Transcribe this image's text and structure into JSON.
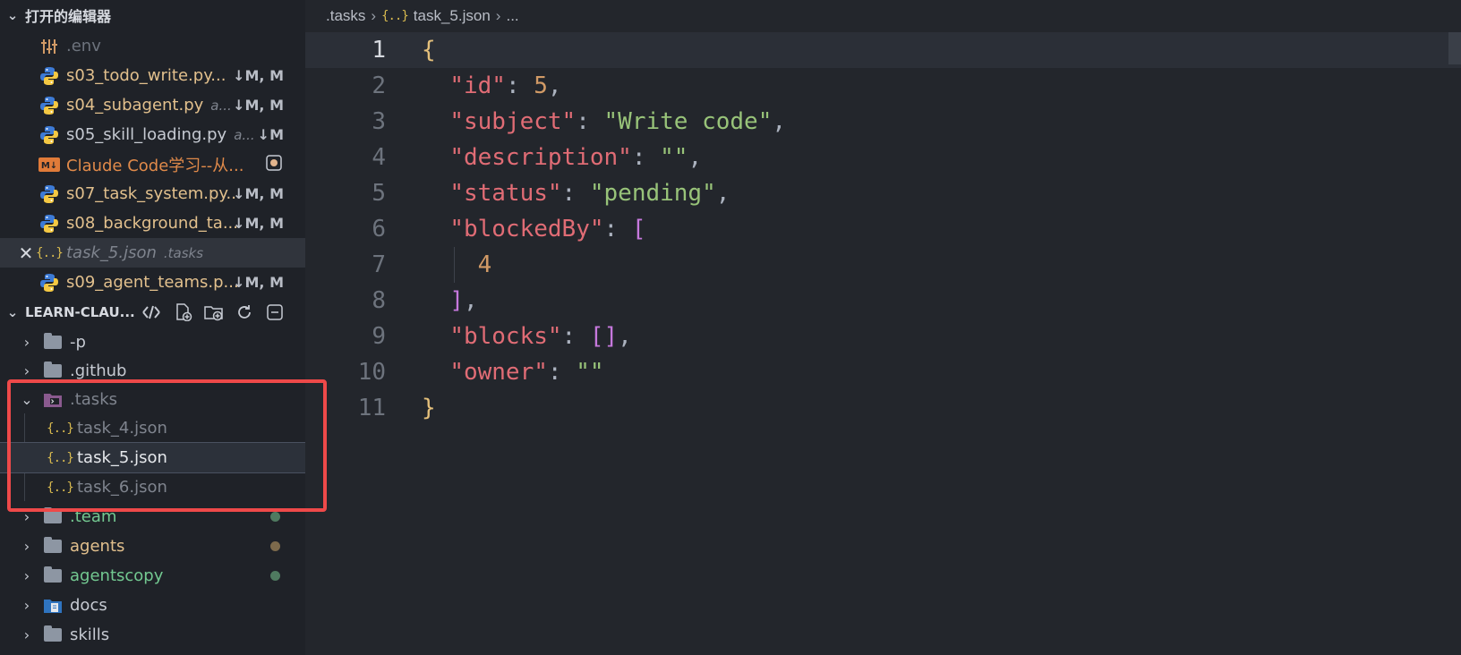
{
  "sidebar": {
    "open_editors": {
      "title": "打开的编辑器",
      "items": [
        {
          "name": ".env",
          "desc": "",
          "status": "",
          "icon": "settings-file-icon"
        },
        {
          "name": "s03_todo_write.py...",
          "desc": "",
          "status": "↓M, M",
          "icon": "python-icon"
        },
        {
          "name": "s04_subagent.py",
          "desc": "a...",
          "status": "↓M, M",
          "icon": "python-icon"
        },
        {
          "name": "s05_skill_loading.py",
          "desc": "a...",
          "status": "↓M",
          "icon": "python-icon"
        },
        {
          "name": "Claude Code学习--从...",
          "desc": "",
          "status": "●",
          "icon": "markdown-icon"
        },
        {
          "name": "s07_task_system.py...",
          "desc": "",
          "status": "↓M, M",
          "icon": "python-icon"
        },
        {
          "name": "s08_background_ta...",
          "desc": "",
          "status": "↓M, M",
          "icon": "python-icon"
        },
        {
          "name": "task_5.json",
          "desc": ".tasks",
          "status": "",
          "icon": "json-icon"
        },
        {
          "name": "s09_agent_teams.p...",
          "desc": "",
          "status": "↓M, M",
          "icon": "python-icon"
        }
      ]
    },
    "explorer": {
      "title": "LEARN-CLAU...",
      "tree": [
        {
          "name": "-p",
          "type": "folder",
          "expanded": false
        },
        {
          "name": ".github",
          "type": "folder",
          "expanded": false
        },
        {
          "name": ".tasks",
          "type": "folder",
          "expanded": true
        },
        {
          "name": "task_4.json",
          "type": "file"
        },
        {
          "name": "task_5.json",
          "type": "file",
          "selected": true
        },
        {
          "name": "task_6.json",
          "type": "file"
        },
        {
          "name": ".team",
          "type": "folder",
          "expanded": false
        },
        {
          "name": "agents",
          "type": "folder",
          "expanded": false
        },
        {
          "name": "agentscopy",
          "type": "folder",
          "expanded": false
        },
        {
          "name": "docs",
          "type": "folder",
          "expanded": false
        },
        {
          "name": "skills",
          "type": "folder",
          "expanded": false
        }
      ]
    }
  },
  "breadcrumb": {
    "folder": ".tasks",
    "file": "task_5.json",
    "more": "..."
  },
  "editor": {
    "line_numbers": [
      "1",
      "2",
      "3",
      "4",
      "5",
      "6",
      "7",
      "8",
      "9",
      "10",
      "11"
    ],
    "json": {
      "id": "5",
      "subject": "Write code",
      "description": "",
      "status": "pending",
      "blockedBy": [
        "4"
      ],
      "blocks": [],
      "owner": ""
    },
    "keys": {
      "id": "\"id\"",
      "subject": "\"subject\"",
      "description": "\"description\"",
      "status": "\"status\"",
      "blockedBy": "\"blockedBy\"",
      "blocks": "\"blocks\"",
      "owner": "\"owner\""
    },
    "values": {
      "id": "5",
      "subject": "\"Write code\"",
      "description": "\"\"",
      "status": "\"pending\"",
      "blockedBy_item": "4",
      "owner": "\"\""
    }
  },
  "colors": {
    "modified_yellow": "#e2c08d",
    "untracked_green": "#73c991",
    "highlight_red": "#ee4949",
    "python_blue": "#3d7bd6",
    "python_yellow": "#f4c843"
  }
}
